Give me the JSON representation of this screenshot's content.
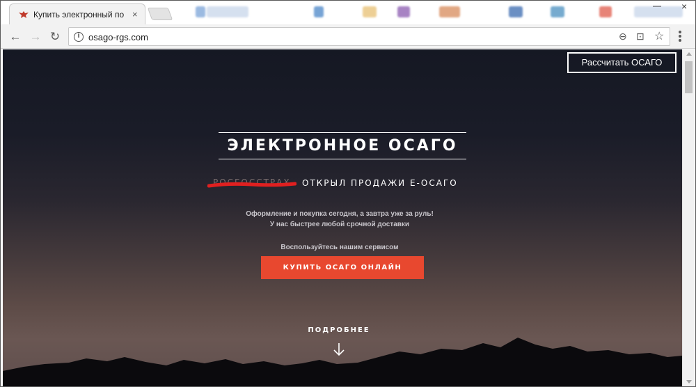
{
  "browser": {
    "tab_title": "Купить электронный по",
    "tab_close": "×",
    "url": "osago-rgs.com",
    "background_tab_text": "Руководители",
    "window_controls": {
      "minimize": "—",
      "close": "×"
    }
  },
  "toolbar_icons": {
    "back": "←",
    "forward": "→",
    "reload": "↻",
    "zoom": "⊖",
    "translate": "⊡",
    "bookmark": "☆"
  },
  "header": {
    "cta_label": "Рассчитать ОСАГО"
  },
  "hero": {
    "title": "ЭЛЕКТРОННОЕ ОСАГО",
    "struck_text": "РОСГОССТРАХ",
    "subtitle": "ОТКРЫЛ ПРОДАЖИ Е-ОСАГО",
    "desc_line1": "Оформление и покупка сегодня, а завтра уже за руль!",
    "desc_line2": "У нас быстрее любой срочной доставки",
    "service_text": "Воспользуйтесь нашим сервисом",
    "buy_button": "КУПИТЬ ОСАГО ОНЛАЙН",
    "more_label": "ПОДРОБНЕЕ"
  },
  "colors": {
    "accent": "#e8482f",
    "strike_red": "#e02020",
    "sky_top": "#151823",
    "sky_bottom": "#6a5753"
  }
}
